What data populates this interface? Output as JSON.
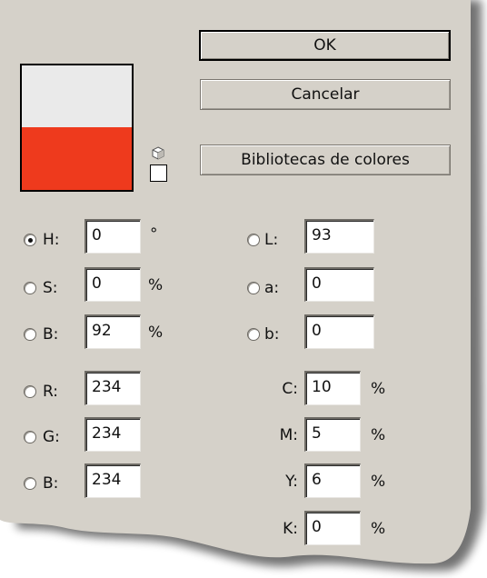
{
  "buttons": {
    "ok": "OK",
    "cancel": "Cancelar",
    "libraries": "Bibliotecas de colores"
  },
  "colors": {
    "panel_bg": "#d5d1c9",
    "swatch_new": "#eaeaea",
    "swatch_old": "#ee3a1d"
  },
  "hsb": {
    "h": {
      "label": "H:",
      "value": "0",
      "unit": "°",
      "selected": true
    },
    "s": {
      "label": "S:",
      "value": "0",
      "unit": "%"
    },
    "b": {
      "label": "B:",
      "value": "92",
      "unit": "%"
    }
  },
  "lab": {
    "l": {
      "label": "L:",
      "value": "93"
    },
    "a": {
      "label": "a:",
      "value": "0"
    },
    "b": {
      "label": "b:",
      "value": "0"
    }
  },
  "rgb": {
    "r": {
      "label": "R:",
      "value": "234"
    },
    "g": {
      "label": "G:",
      "value": "234"
    },
    "b": {
      "label": "B:",
      "value": "234"
    }
  },
  "cmyk": {
    "c": {
      "label": "C:",
      "value": "10",
      "unit": "%"
    },
    "m": {
      "label": "M:",
      "value": "5",
      "unit": "%"
    },
    "y": {
      "label": "Y:",
      "value": "6",
      "unit": "%"
    },
    "k": {
      "label": "K:",
      "value": "0",
      "unit": "%"
    }
  }
}
